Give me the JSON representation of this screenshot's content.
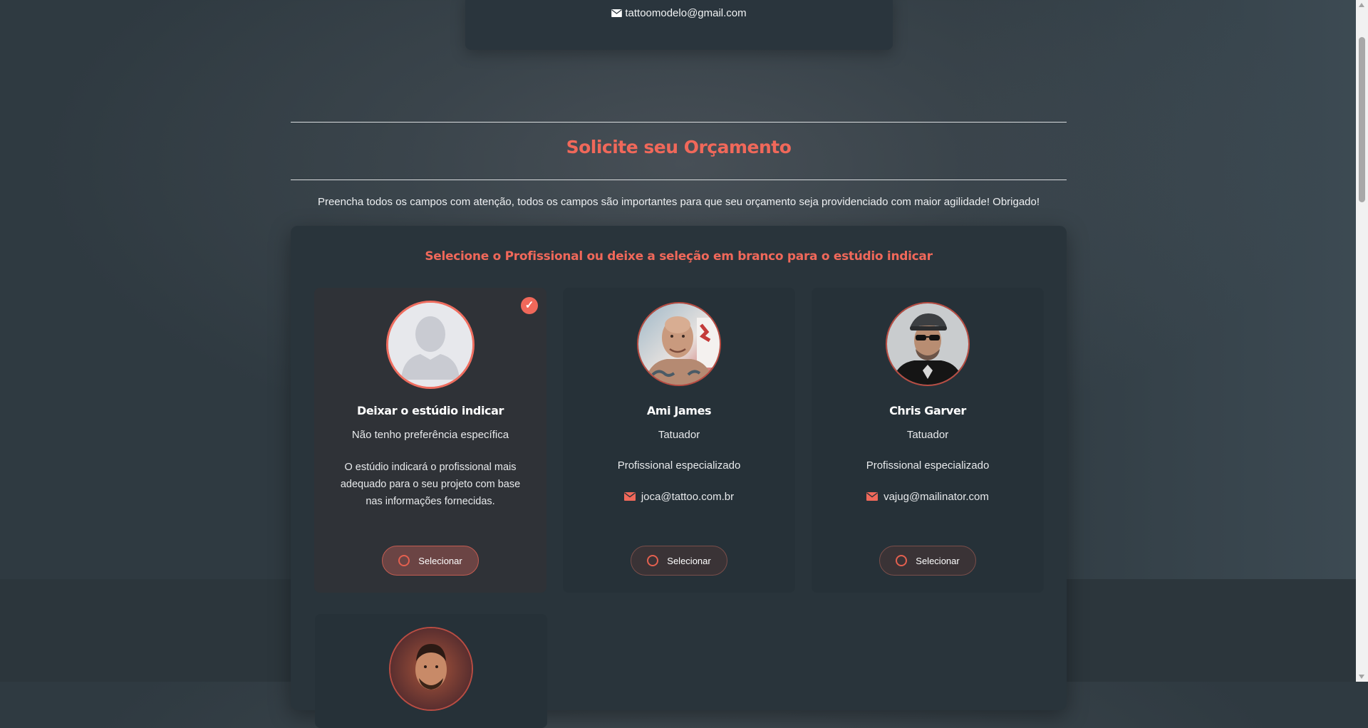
{
  "contact": {
    "email": "tattoomodelo@gmail.com"
  },
  "section": {
    "title": "Solicite seu Orçamento",
    "subtitle": "Preencha todos os campos com atenção, todos os campos são importantes para que seu orçamento seja providenciado com maior agilidade! Obrigado!"
  },
  "panel": {
    "title": "Selecione o Profissional ou deixe a seleção em branco para o estúdio indicar"
  },
  "professionals": [
    {
      "name": "Deixar o estúdio indicar",
      "role": "Não tenho preferência específica",
      "description": "O estúdio indicará o profissional mais adequado para o seu projeto com base nas informações fornecidas.",
      "button": "Selecionar",
      "selected": true,
      "check_icon": "check-icon"
    },
    {
      "name": "Ami James",
      "role": "Tatuador",
      "specialty": "Profissional especializado",
      "email": "joca@tattoo.com.br",
      "button": "Selecionar",
      "selected": false
    },
    {
      "name": "Chris Garver",
      "role": "Tatuador",
      "specialty": "Profissional especializado",
      "email": "vajug@mailinator.com",
      "button": "Selecionar",
      "selected": false
    }
  ],
  "colors": {
    "accent": "#f0685a",
    "card_bg": "#263138",
    "panel_bg": "#29343b"
  }
}
